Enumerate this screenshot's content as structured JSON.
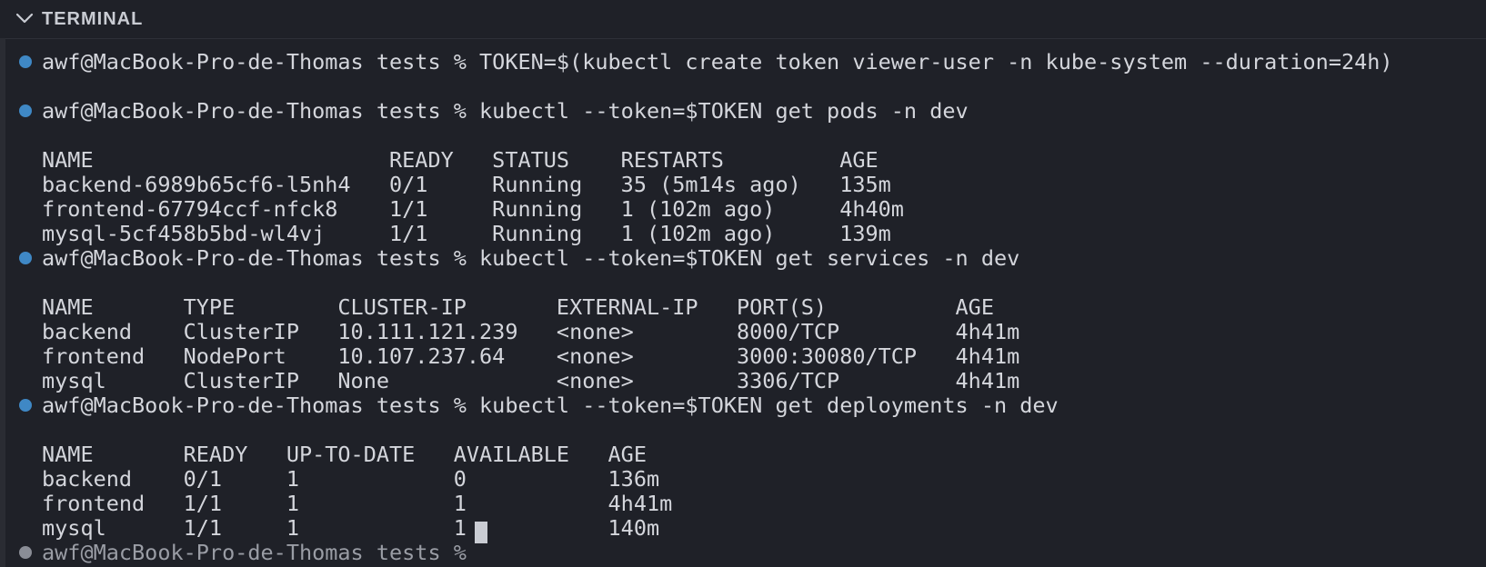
{
  "panel": {
    "title": "TERMINAL",
    "collapse_icon": "chevron-down-icon"
  },
  "colors": {
    "background": "#1f2128",
    "text": "#d4d6dc",
    "prompt_dot": "#3f88c5"
  },
  "terminal": {
    "commands": [
      "awf@MacBook-Pro-de-Thomas tests % TOKEN=$(kubectl create token viewer-user -n kube-system --duration=24h)",
      "awf@MacBook-Pro-de-Thomas tests % kubectl --token=$TOKEN get pods -n dev",
      "awf@MacBook-Pro-de-Thomas tests % kubectl --token=$TOKEN get services -n dev",
      "awf@MacBook-Pro-de-Thomas tests % kubectl --token=$TOKEN get deployments -n dev"
    ],
    "pods": [
      "NAME                       READY   STATUS    RESTARTS         AGE",
      "backend-6989b65cf6-l5nh4   0/1     Running   35 (5m14s ago)   135m",
      "frontend-67794ccf-nfck8    1/1     Running   1 (102m ago)     4h40m",
      "mysql-5cf458b5bd-wl4vj     1/1     Running   1 (102m ago)     139m"
    ],
    "services": [
      "NAME       TYPE        CLUSTER-IP       EXTERNAL-IP   PORT(S)          AGE",
      "backend    ClusterIP   10.111.121.239   <none>        8000/TCP         4h41m",
      "frontend   NodePort    10.107.237.64    <none>        3000:30080/TCP   4h41m",
      "mysql      ClusterIP   None             <none>        3306/TCP         4h41m"
    ],
    "deployments": [
      "NAME       READY   UP-TO-DATE   AVAILABLE   AGE",
      "backend    0/1     1            0           136m",
      "frontend   1/1     1            1           4h41m",
      "mysql      1/1     1            1           140m"
    ],
    "current_prompt": "awf@MacBook-Pro-de-Thomas tests % "
  }
}
